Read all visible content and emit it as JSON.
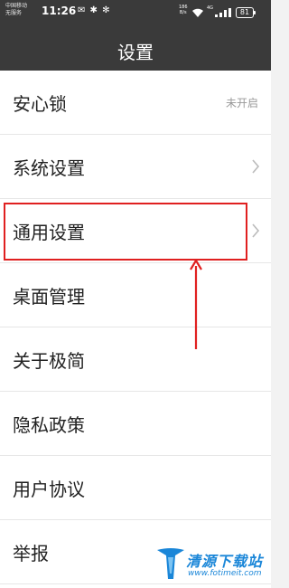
{
  "status_bar": {
    "carrier_line1": "中国移动",
    "carrier_line2": "无服务",
    "time": "11:26",
    "icons_left": "✉ ✱ ✻",
    "net_speed_value": "186",
    "net_speed_unit": "B/s",
    "signal_label": "4G",
    "battery": "81",
    "icons": [
      "mail-icon",
      "bluetooth-icon",
      "settings-icon",
      "wifi-icon",
      "signal-icon",
      "battery-icon"
    ]
  },
  "header": {
    "title": "设置"
  },
  "menu": {
    "items": [
      {
        "label": "安心锁",
        "value": "未开启",
        "chevron": false
      },
      {
        "label": "系统设置",
        "value": "",
        "chevron": true
      },
      {
        "label": "通用设置",
        "value": "",
        "chevron": true
      },
      {
        "label": "桌面管理",
        "value": "",
        "chevron": false
      },
      {
        "label": "关于极简",
        "value": "",
        "chevron": false
      },
      {
        "label": "隐私政策",
        "value": "",
        "chevron": false
      },
      {
        "label": "用户协议",
        "value": "",
        "chevron": false
      },
      {
        "label": "举报",
        "value": "",
        "chevron": false
      }
    ]
  },
  "annotation": {
    "highlight_color": "#e02020",
    "highlighted_item": "通用设置"
  },
  "watermark": {
    "text": "清源下载站",
    "url": "www.fotimeit.com",
    "color": "#1a86d8"
  },
  "colors": {
    "bar_background": "#3a3a3a",
    "list_background": "#ffffff",
    "text_primary": "#222222",
    "text_secondary": "#999999",
    "divider": "#e6e6e6"
  }
}
